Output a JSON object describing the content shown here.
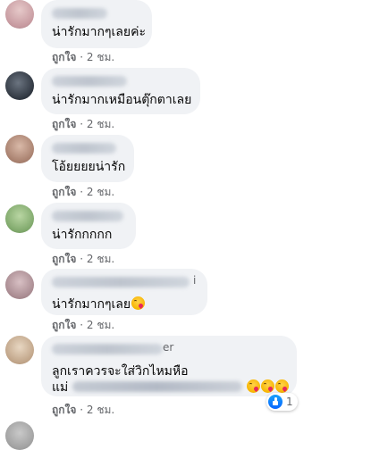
{
  "comments": [
    {
      "text": "น่ารักมากๆเลยค่ะ",
      "like_label": "ถูกใจ",
      "time": "2 ชม."
    },
    {
      "text": "น่ารักมากเหมือนตุ๊กตาเลย",
      "like_label": "ถูกใจ",
      "time": "2 ชม."
    },
    {
      "text": "โอ้ยยยยน่ารัก",
      "like_label": "ถูกใจ",
      "time": "2 ชม."
    },
    {
      "text": "น่ารักกกกก",
      "like_label": "ถูกใจ",
      "time": "2 ชม."
    },
    {
      "name_tail": "i",
      "text": "น่ารักมากๆเลย",
      "like_label": "ถูกใจ",
      "time": "2 ชม."
    },
    {
      "name_tail": "er",
      "text_line1": "ลูกเราควรจะใส่วิกไหมหือ",
      "text_line2": "แม่",
      "reaction_count": "1",
      "like_label": "ถูกใจ",
      "time": "2 ชม."
    }
  ],
  "separator": "·",
  "colors": {
    "bubble": "#f0f2f5",
    "meta": "#65676b",
    "like_blue": "#0866ff"
  },
  "icons": {
    "emoji": "kissing-heart-emoji",
    "reaction": "like-reaction-icon"
  }
}
